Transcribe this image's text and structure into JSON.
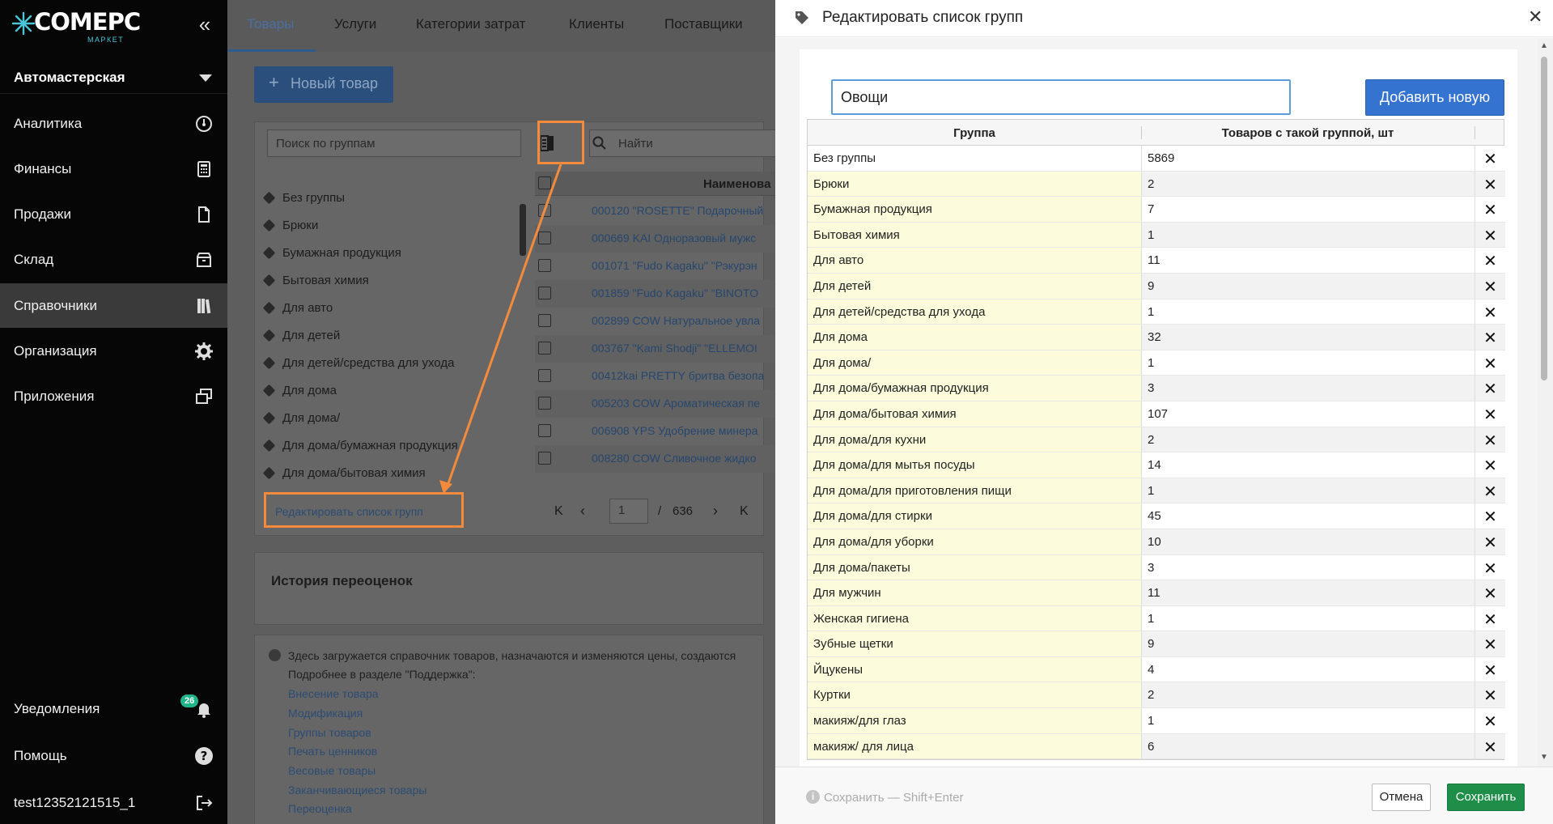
{
  "sidebar": {
    "logo_text": "COMEPC",
    "logo_sub": "МАРКЕТ",
    "collapse_icon": "«",
    "company": "Автомастерская",
    "items": [
      {
        "label": "Аналитика",
        "icon": "gauge-icon"
      },
      {
        "label": "Финансы",
        "icon": "calculator-icon"
      },
      {
        "label": "Продажи",
        "icon": "document-icon"
      },
      {
        "label": "Склад",
        "icon": "box-icon"
      },
      {
        "label": "Справочники",
        "icon": "books-icon",
        "active": true
      },
      {
        "label": "Организация",
        "icon": "gear-icon"
      },
      {
        "label": "Приложения",
        "icon": "windows-icon"
      }
    ],
    "notifications_label": "Уведомления",
    "notifications_count": "26",
    "help_label": "Помощь",
    "user": "test12352121515_1"
  },
  "background": {
    "tabs": [
      "Товары",
      "Услуги",
      "Категории затрат",
      "Клиенты",
      "Поставщики"
    ],
    "new_button": "Новый товар",
    "search_groups_placeholder": "Поиск по группам",
    "find_placeholder": "Найти",
    "column_name": "Наименова",
    "groups": [
      "Без группы",
      "Брюки",
      "Бумажная продукция",
      "Бытовая химия",
      "Для авто",
      "Для детей",
      "Для детей/средства для ухода",
      "Для дома",
      "Для дома/",
      "Для дома/бумажная продукция",
      "Для дома/бытовая химия"
    ],
    "products": [
      "000120 \"ROSETTE\" Подарочный",
      "000669 KAI Одноразовый мужс",
      "001071 \"Fudo Kagaku\" \"Рэкурэн",
      "001859 \"Fudo Kagaku\" \"BINOTO",
      "002899 COW Натуральное увла",
      "003767 \"Kami Shodji\" \"ELLEMOI",
      "00412kai PRETTY бритва безопа",
      "005203 COW Ароматическая пе",
      "006908 YPS Удобрение минера",
      "008280 COW Сливочное жидко"
    ],
    "edit_groups_link": "Редактировать список групп",
    "page_current": "1",
    "page_total": "636",
    "history_title": "История переоценок",
    "info_text": "Здесь загружается справочник товаров, назначаются и изменяются цены, создаются",
    "info_more": "Подробнее в разделе \"Поддержка\":",
    "help_links": [
      "Внесение товара",
      "Модификация",
      "Группы товаров",
      "Печать ценников",
      "Весовые товары",
      "Заканчивающиеся товары",
      "Переоценка"
    ]
  },
  "modal": {
    "title": "Редактировать список групп",
    "input_value": "Овощи",
    "add_button": "Добавить новую",
    "col_group": "Группа",
    "col_count": "Товаров с такой группой, шт",
    "rows": [
      {
        "group": "Без группы",
        "count": "5869"
      },
      {
        "group": "Брюки",
        "count": "2"
      },
      {
        "group": "Бумажная продукция",
        "count": "7"
      },
      {
        "group": "Бытовая химия",
        "count": "1"
      },
      {
        "group": "Для авто",
        "count": "11"
      },
      {
        "group": "Для детей",
        "count": "9"
      },
      {
        "group": "Для детей/средства для ухода",
        "count": "1"
      },
      {
        "group": "Для дома",
        "count": "32"
      },
      {
        "group": "Для дома/",
        "count": "1"
      },
      {
        "group": "Для дома/бумажная продукция",
        "count": "3"
      },
      {
        "group": "Для дома/бытовая химия",
        "count": "107"
      },
      {
        "group": "Для дома/для кухни",
        "count": "2"
      },
      {
        "group": "Для дома/для мытья посуды",
        "count": "14"
      },
      {
        "group": "Для дома/для приготовления пищи",
        "count": "1"
      },
      {
        "group": "Для дома/для стирки",
        "count": "45"
      },
      {
        "group": "Для дома/для уборки",
        "count": "10"
      },
      {
        "group": "Для дома/пакеты",
        "count": "3"
      },
      {
        "group": "Для мужчин",
        "count": "11"
      },
      {
        "group": "Женская гигиена",
        "count": "1"
      },
      {
        "group": "Зубные щетки",
        "count": "9"
      },
      {
        "group": "Йцукены",
        "count": "4"
      },
      {
        "group": "Куртки",
        "count": "2"
      },
      {
        "group": "макияж/для глаз",
        "count": "1"
      },
      {
        "group": "макияж/ для лица",
        "count": "6"
      }
    ],
    "save_hint": "Сохранить — Shift+Enter",
    "cancel": "Отмена",
    "save": "Сохранить"
  },
  "colors": {
    "accent": "#3573d1",
    "save": "#1e8e49",
    "annotation": "#f48a3c",
    "group_cell": "#fcfcdc"
  }
}
